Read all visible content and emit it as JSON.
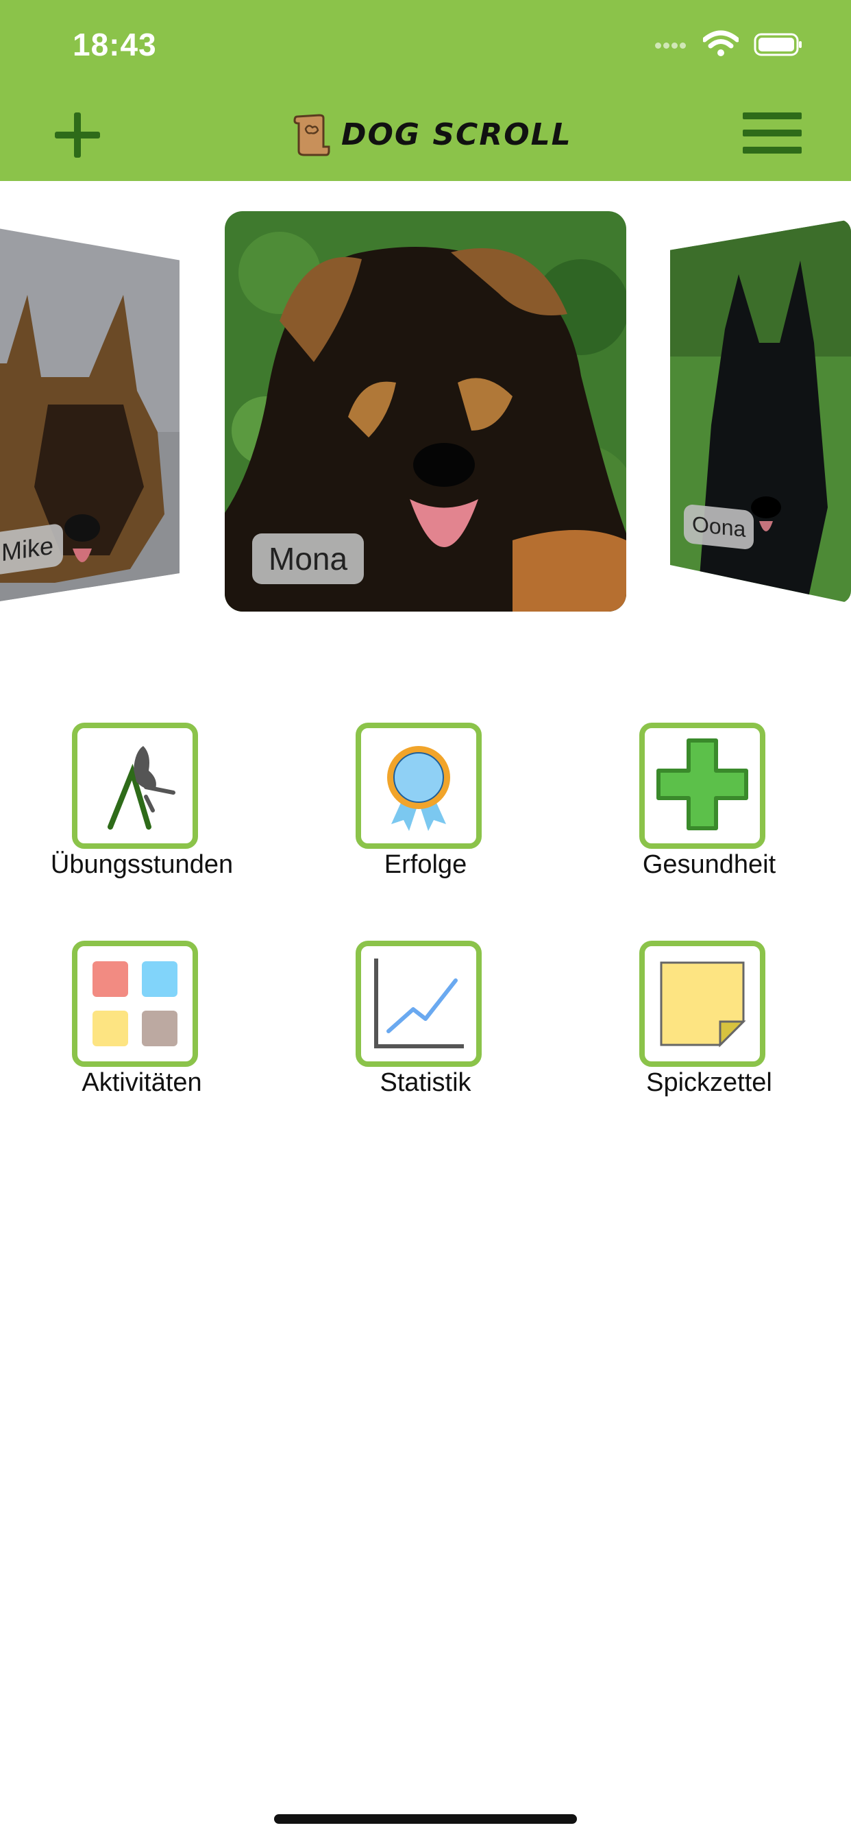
{
  "status_bar": {
    "time": "18:43"
  },
  "header": {
    "app_name": "DOG SCROLL",
    "colors": {
      "bar": "#8bc34a",
      "icon": "#2e6b19"
    }
  },
  "carousel": {
    "dogs": [
      {
        "name": "Mike",
        "position": "left"
      },
      {
        "name": "Mona",
        "position": "center"
      },
      {
        "name": "Oona",
        "position": "right"
      }
    ]
  },
  "menu": {
    "items": [
      {
        "label": "Übungsstunden",
        "icon": "trainer-with-dog-icon"
      },
      {
        "label": "Erfolge",
        "icon": "award-ribbon-icon"
      },
      {
        "label": "Gesundheit",
        "icon": "medical-cross-icon"
      },
      {
        "label": "Aktivitäten",
        "icon": "color-grid-icon"
      },
      {
        "label": "Statistik",
        "icon": "line-chart-icon"
      },
      {
        "label": "Spickzettel",
        "icon": "sticky-note-icon"
      }
    ]
  }
}
